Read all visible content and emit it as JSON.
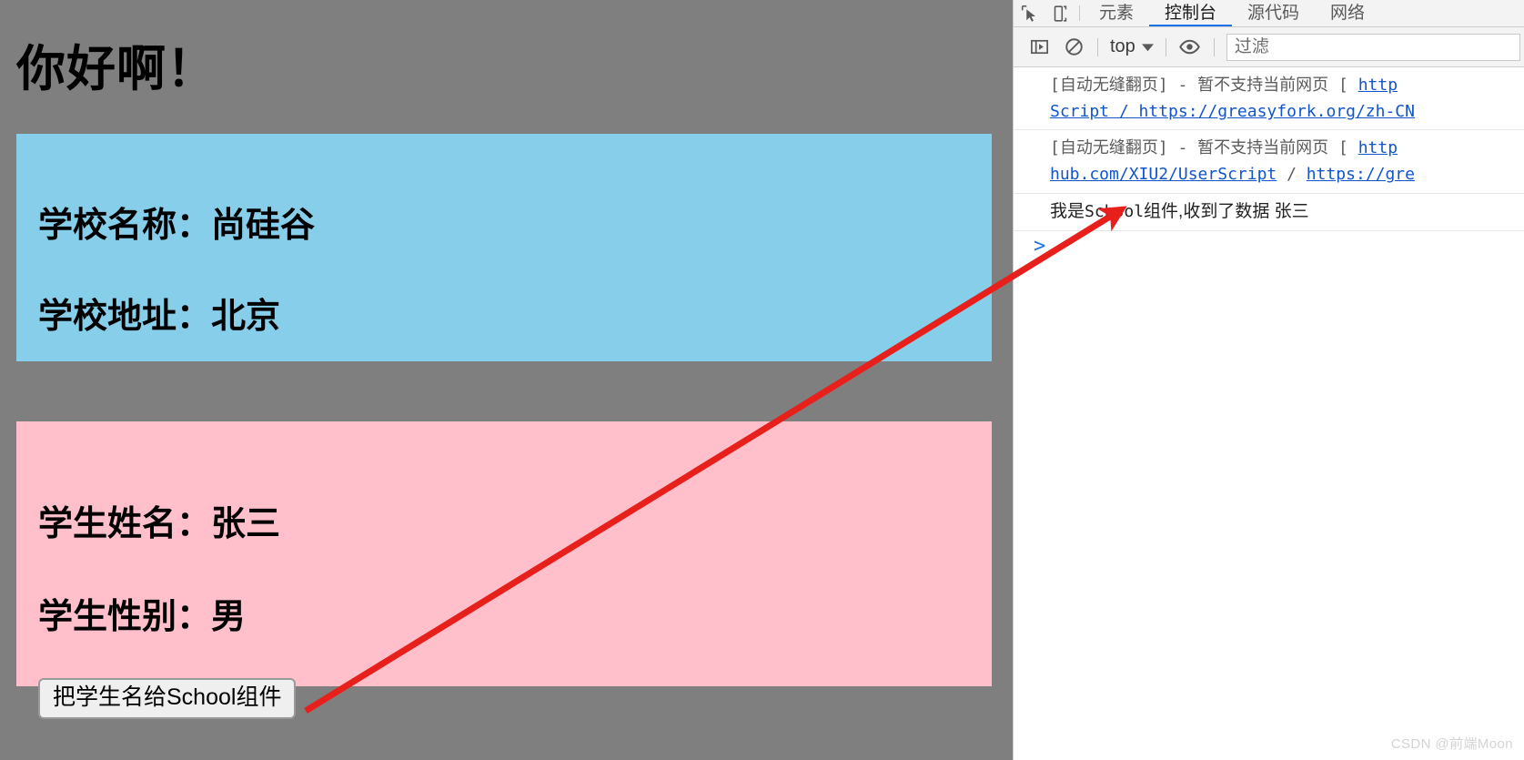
{
  "page": {
    "title": "你好啊！",
    "background_color": "#807f80",
    "school": {
      "card_color": "#87ceeb",
      "name_line": "学校名称：尚硅谷",
      "address_line": "学校地址：北京"
    },
    "student": {
      "card_color": "#ffc0cb",
      "name_line": "学生姓名：张三",
      "gender_line": "学生性别：男",
      "button_label": "把学生名给School组件"
    }
  },
  "devtools": {
    "icons": {
      "inspect": "inspect-element-icon",
      "device": "device-toolbar-icon",
      "sidebar": "console-sidebar-icon",
      "clear": "clear-console-icon",
      "eye": "live-expression-icon",
      "chevron": "chevron-down-icon"
    },
    "tabs": [
      {
        "label": "元素",
        "active": false
      },
      {
        "label": "控制台",
        "active": true
      },
      {
        "label": "源代码",
        "active": false
      },
      {
        "label": "网络",
        "active": false
      }
    ],
    "toolbar": {
      "context_value": "top",
      "filter_placeholder": "过滤",
      "filter_value": ""
    },
    "console": {
      "accent_color": "#1a73e8",
      "link_color": "#1155cc",
      "messages": [
        {
          "kind": "violation",
          "prefix": "[自动无缝翻页] - 暂不支持当前网页 [ ",
          "link1": "http",
          "mid": "Script / ",
          "link2": "https://greasyfork.org/zh-CN"
        },
        {
          "kind": "violation",
          "prefix": "[自动无缝翻页] - 暂不支持当前网页 [ ",
          "link1": "http",
          "mid": "",
          "link2": "hub.com/XIU2/UserScript",
          "sep": " / ",
          "link3": "https://gre"
        },
        {
          "kind": "plain",
          "text_before": "我是",
          "mono": "School",
          "text_after": "组件,收到了数据 张三"
        }
      ],
      "prompt": ">"
    },
    "watermark": "CSDN @前端Moon"
  },
  "annotation": {
    "arrow_color": "#e8201c",
    "from": "把学生名给School组件",
    "to": "我是School组件,收到了数据 张三"
  }
}
